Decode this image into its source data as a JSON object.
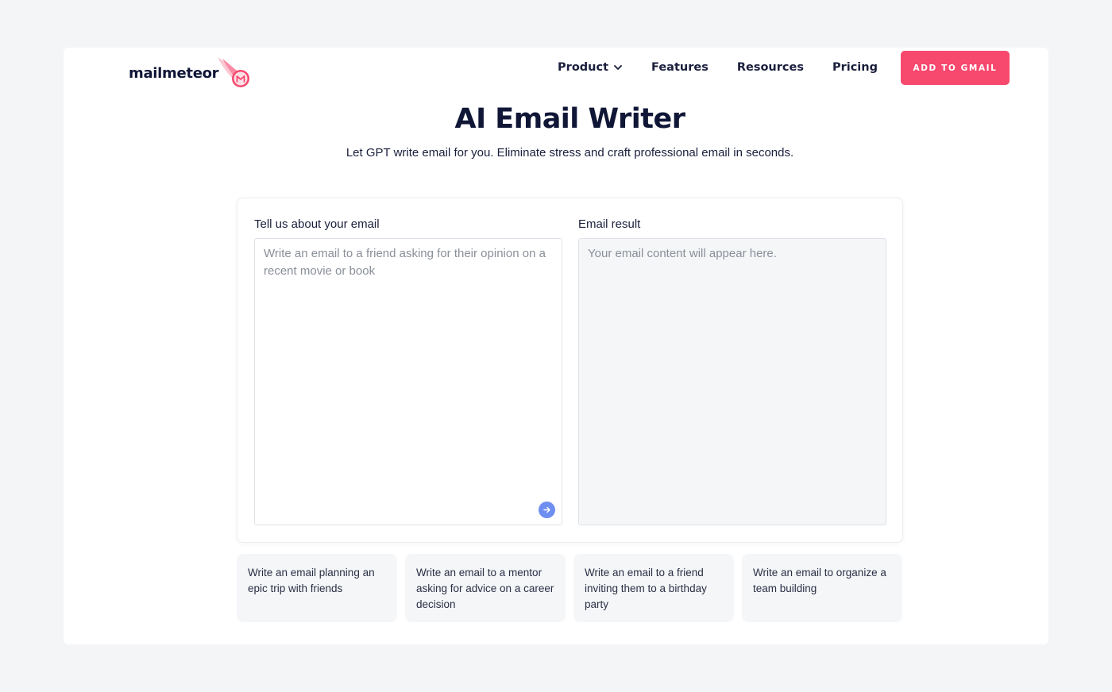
{
  "brand": {
    "name": "mailmeteor",
    "accent": "#f7486e"
  },
  "nav": {
    "items": [
      {
        "label": "Product",
        "has_dropdown": true
      },
      {
        "label": "Features"
      },
      {
        "label": "Resources"
      },
      {
        "label": "Pricing"
      }
    ],
    "cta_label": "ADD TO GMAIL"
  },
  "hero": {
    "title": "AI Email Writer",
    "subtitle": "Let GPT write email for you. Eliminate stress and craft professional email in seconds."
  },
  "tool": {
    "input_label": "Tell us about your email",
    "input_value": "",
    "input_placeholder": "Write an email to a friend asking for their opinion on a recent movie or book",
    "result_label": "Email result",
    "result_placeholder": "Your email content will appear here.",
    "send_icon": "arrow-right-icon"
  },
  "suggestions": [
    "Write an email planning an epic trip with friends",
    "Write an email to a mentor asking for advice on a career decision",
    "Write an email to a friend inviting them to a birthday party",
    "Write an email to organize a team building"
  ]
}
